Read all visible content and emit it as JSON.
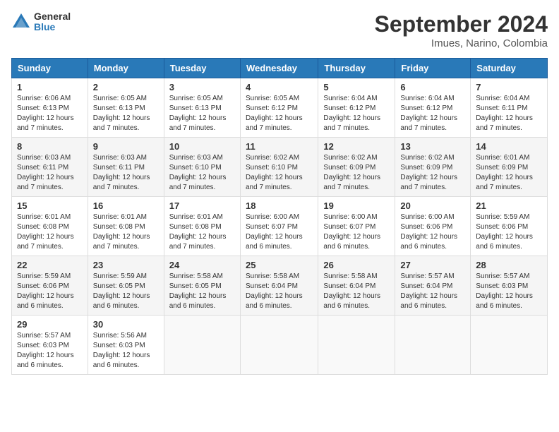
{
  "header": {
    "logo": {
      "line1": "General",
      "line2": "Blue"
    },
    "title": "September 2024",
    "subtitle": "Imues, Narino, Colombia"
  },
  "weekdays": [
    "Sunday",
    "Monday",
    "Tuesday",
    "Wednesday",
    "Thursday",
    "Friday",
    "Saturday"
  ],
  "weeks": [
    [
      {
        "day": "1",
        "sunrise": "6:06 AM",
        "sunset": "6:13 PM",
        "daylight": "12 hours and 7 minutes."
      },
      {
        "day": "2",
        "sunrise": "6:05 AM",
        "sunset": "6:13 PM",
        "daylight": "12 hours and 7 minutes."
      },
      {
        "day": "3",
        "sunrise": "6:05 AM",
        "sunset": "6:13 PM",
        "daylight": "12 hours and 7 minutes."
      },
      {
        "day": "4",
        "sunrise": "6:05 AM",
        "sunset": "6:12 PM",
        "daylight": "12 hours and 7 minutes."
      },
      {
        "day": "5",
        "sunrise": "6:04 AM",
        "sunset": "6:12 PM",
        "daylight": "12 hours and 7 minutes."
      },
      {
        "day": "6",
        "sunrise": "6:04 AM",
        "sunset": "6:12 PM",
        "daylight": "12 hours and 7 minutes."
      },
      {
        "day": "7",
        "sunrise": "6:04 AM",
        "sunset": "6:11 PM",
        "daylight": "12 hours and 7 minutes."
      }
    ],
    [
      {
        "day": "8",
        "sunrise": "6:03 AM",
        "sunset": "6:11 PM",
        "daylight": "12 hours and 7 minutes."
      },
      {
        "day": "9",
        "sunrise": "6:03 AM",
        "sunset": "6:11 PM",
        "daylight": "12 hours and 7 minutes."
      },
      {
        "day": "10",
        "sunrise": "6:03 AM",
        "sunset": "6:10 PM",
        "daylight": "12 hours and 7 minutes."
      },
      {
        "day": "11",
        "sunrise": "6:02 AM",
        "sunset": "6:10 PM",
        "daylight": "12 hours and 7 minutes."
      },
      {
        "day": "12",
        "sunrise": "6:02 AM",
        "sunset": "6:09 PM",
        "daylight": "12 hours and 7 minutes."
      },
      {
        "day": "13",
        "sunrise": "6:02 AM",
        "sunset": "6:09 PM",
        "daylight": "12 hours and 7 minutes."
      },
      {
        "day": "14",
        "sunrise": "6:01 AM",
        "sunset": "6:09 PM",
        "daylight": "12 hours and 7 minutes."
      }
    ],
    [
      {
        "day": "15",
        "sunrise": "6:01 AM",
        "sunset": "6:08 PM",
        "daylight": "12 hours and 7 minutes."
      },
      {
        "day": "16",
        "sunrise": "6:01 AM",
        "sunset": "6:08 PM",
        "daylight": "12 hours and 7 minutes."
      },
      {
        "day": "17",
        "sunrise": "6:01 AM",
        "sunset": "6:08 PM",
        "daylight": "12 hours and 7 minutes."
      },
      {
        "day": "18",
        "sunrise": "6:00 AM",
        "sunset": "6:07 PM",
        "daylight": "12 hours and 6 minutes."
      },
      {
        "day": "19",
        "sunrise": "6:00 AM",
        "sunset": "6:07 PM",
        "daylight": "12 hours and 6 minutes."
      },
      {
        "day": "20",
        "sunrise": "6:00 AM",
        "sunset": "6:06 PM",
        "daylight": "12 hours and 6 minutes."
      },
      {
        "day": "21",
        "sunrise": "5:59 AM",
        "sunset": "6:06 PM",
        "daylight": "12 hours and 6 minutes."
      }
    ],
    [
      {
        "day": "22",
        "sunrise": "5:59 AM",
        "sunset": "6:06 PM",
        "daylight": "12 hours and 6 minutes."
      },
      {
        "day": "23",
        "sunrise": "5:59 AM",
        "sunset": "6:05 PM",
        "daylight": "12 hours and 6 minutes."
      },
      {
        "day": "24",
        "sunrise": "5:58 AM",
        "sunset": "6:05 PM",
        "daylight": "12 hours and 6 minutes."
      },
      {
        "day": "25",
        "sunrise": "5:58 AM",
        "sunset": "6:04 PM",
        "daylight": "12 hours and 6 minutes."
      },
      {
        "day": "26",
        "sunrise": "5:58 AM",
        "sunset": "6:04 PM",
        "daylight": "12 hours and 6 minutes."
      },
      {
        "day": "27",
        "sunrise": "5:57 AM",
        "sunset": "6:04 PM",
        "daylight": "12 hours and 6 minutes."
      },
      {
        "day": "28",
        "sunrise": "5:57 AM",
        "sunset": "6:03 PM",
        "daylight": "12 hours and 6 minutes."
      }
    ],
    [
      {
        "day": "29",
        "sunrise": "5:57 AM",
        "sunset": "6:03 PM",
        "daylight": "12 hours and 6 minutes."
      },
      {
        "day": "30",
        "sunrise": "5:56 AM",
        "sunset": "6:03 PM",
        "daylight": "12 hours and 6 minutes."
      },
      null,
      null,
      null,
      null,
      null
    ]
  ]
}
